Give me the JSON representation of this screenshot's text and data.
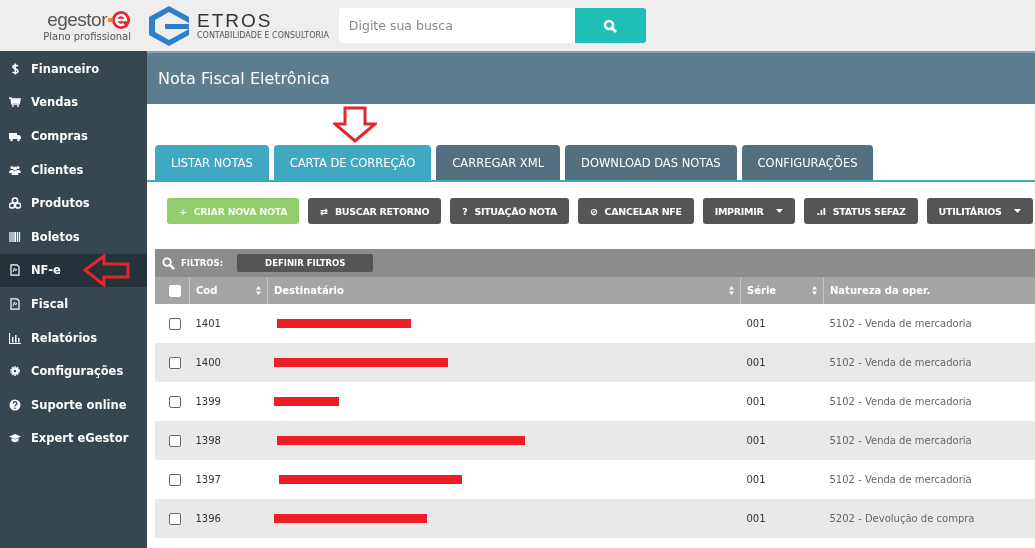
{
  "header": {
    "brand": "egestor",
    "plan": "Plano profissional",
    "partner_logo": "ETROS",
    "partner_tagline": "CONTABILIDADE E CONSULTORIA",
    "search": {
      "placeholder": "Digite sua busca"
    }
  },
  "sidebar": {
    "items": [
      {
        "label": "Financeiro",
        "kind": "dollar",
        "selected": false
      },
      {
        "label": "Vendas",
        "kind": "cart",
        "selected": false
      },
      {
        "label": "Compras",
        "kind": "truck",
        "selected": false
      },
      {
        "label": "Clientes",
        "kind": "users",
        "selected": false
      },
      {
        "label": "Produtos",
        "kind": "cubes",
        "selected": false
      },
      {
        "label": "Boletos",
        "kind": "barcode",
        "selected": false
      },
      {
        "label": "NF-e",
        "kind": "doc",
        "selected": true
      },
      {
        "label": "Fiscal",
        "kind": "doc",
        "selected": false
      },
      {
        "label": "Relatórios",
        "kind": "chart",
        "selected": false
      },
      {
        "label": "Configurações",
        "kind": "gear",
        "selected": false
      },
      {
        "label": "Suporte online",
        "kind": "help",
        "selected": false
      },
      {
        "label": "Expert eGestor",
        "kind": "cap",
        "selected": false
      }
    ]
  },
  "page_title": "Nota Fiscal Eletrônica",
  "tabs": [
    {
      "label": "LISTAR NOTAS",
      "selected": true
    },
    {
      "label": "CARTA DE CORREÇÃO",
      "selected": true
    },
    {
      "label": "CARREGAR XML",
      "selected": false
    },
    {
      "label": "DOWNLOAD DAS NOTAS",
      "selected": false
    },
    {
      "label": "CONFIGURAÇÕES",
      "selected": false
    }
  ],
  "actions": [
    {
      "label": "CRIAR NOVA NOTA",
      "icon": "+",
      "kind": "primary",
      "dropdown": false
    },
    {
      "label": "BUSCAR RETORNO",
      "icon": "⇄",
      "kind": "default",
      "dropdown": false
    },
    {
      "label": "SITUAÇÃO NOTA",
      "icon": "?",
      "kind": "default",
      "dropdown": false
    },
    {
      "label": "CANCELAR NFE",
      "icon": "⊘",
      "kind": "default",
      "dropdown": false
    },
    {
      "label": "IMPRIMIR",
      "kind": "default",
      "dropdown": true
    },
    {
      "label": "STATUS SEFAZ",
      "icon": ".ıl",
      "kind": "default",
      "dropdown": false
    },
    {
      "label": "UTILITÁRIOS",
      "kind": "default",
      "dropdown": true
    }
  ],
  "filters": {
    "label": "FILTROS:",
    "button": "DEFINIR FILTROS"
  },
  "table": {
    "select_all_checked": false,
    "columns": [
      "Cod",
      "Destinatário",
      "Série",
      "Natureza da oper."
    ],
    "rows": [
      {
        "checked": false,
        "cod": "1401",
        "destinatario_redacted": true,
        "serie": "001",
        "natureza": "5102 - Venda de mercadoria"
      },
      {
        "checked": false,
        "cod": "1400",
        "destinatario_redacted": true,
        "serie": "001",
        "natureza": "5102 - Venda de mercadoria"
      },
      {
        "checked": false,
        "cod": "1399",
        "destinatario_redacted": true,
        "serie": "001",
        "natureza": "5102 - Venda de mercadoria"
      },
      {
        "checked": false,
        "cod": "1398",
        "destinatario_redacted": true,
        "serie": "001",
        "natureza": "5102 - Venda de mercadoria"
      },
      {
        "checked": false,
        "cod": "1397",
        "destinatario_redacted": true,
        "serie": "001",
        "natureza": "5102 - Venda de mercadoria"
      },
      {
        "checked": false,
        "cod": "1396",
        "destinatario_redacted": true,
        "serie": "001",
        "natureza": "5202 - Devolução de compra"
      }
    ]
  },
  "annotations": [
    {
      "kind": "down-arrow"
    },
    {
      "kind": "left-arrow"
    }
  ]
}
